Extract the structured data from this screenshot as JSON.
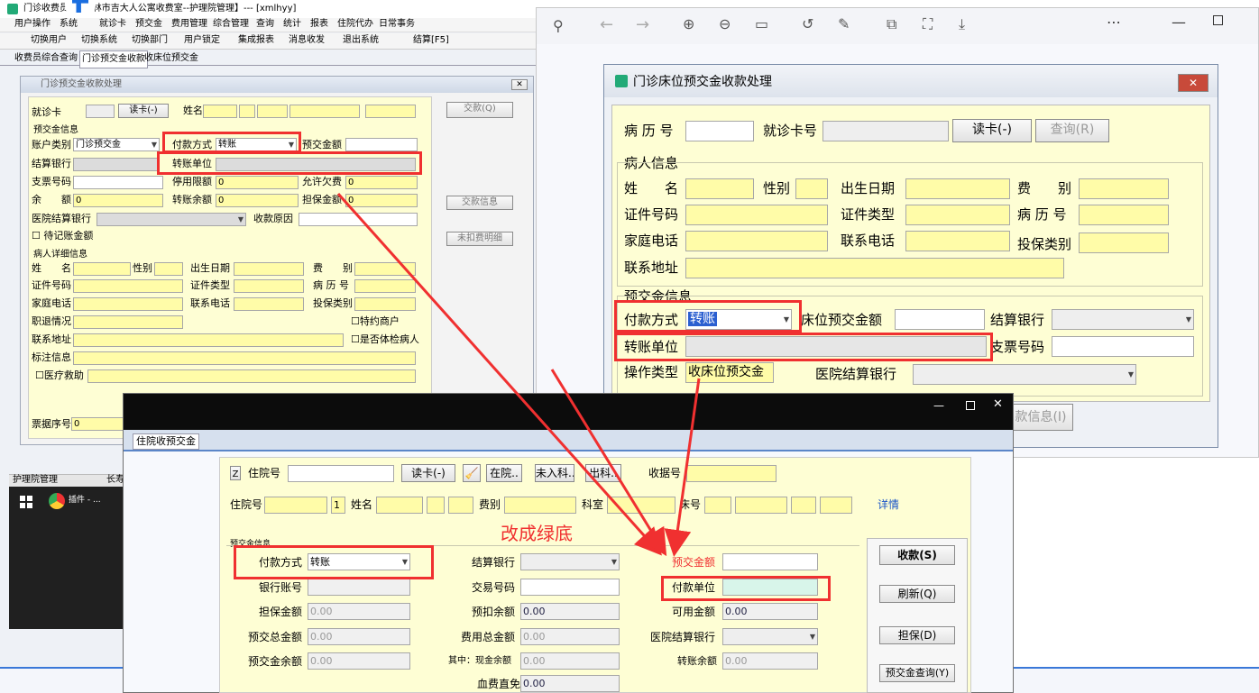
{
  "main": {
    "title": "门诊收费员-...-吉林市吉大人公寓收费室--护理院管理】--- [xmlhyy]",
    "menu": [
      "用户操作",
      "系统",
      "就诊卡",
      "预交金",
      "费用管理",
      "综合管理",
      "查询",
      "统计",
      "报表",
      "住院代办",
      "日常事务"
    ],
    "toolbar": [
      "切换用户",
      "切换系统",
      "切换部门",
      "用户锁定",
      "集成报表",
      "消息收发",
      "退出系统",
      "结算[F5]"
    ],
    "tabs": [
      "收费员综合查询",
      "门诊预交金收款",
      "收床位预交金"
    ],
    "dialog": {
      "title": "门诊预交金收款处理",
      "card_label": "就诊卡",
      "read_card": "读卡(-)",
      "name_label": "姓名",
      "prepay_group": "预交金信息",
      "account_type_label": "账户类别",
      "account_type_value": "门诊预交金",
      "pay_method_label": "付款方式",
      "pay_method_value": "转账",
      "prepay_amount_label": "预交金额",
      "settle_bank_label": "结算银行",
      "transfer_unit_label": "转账单位",
      "check_no_label": "支票号码",
      "disabled_limit_label": "停用限额",
      "disabled_limit_value": "0",
      "allow_debt_label": "允许欠费",
      "allow_debt_value": "0",
      "balance_label": "余　　额",
      "balance_value": "0",
      "transfer_balance_label": "转账余额",
      "transfer_balance_value": "0",
      "guarantee_label": "担保金额",
      "guarantee_value": "0",
      "hospital_bank_label": "医院结算银行",
      "reason_label": "收款原因",
      "pending_label": "待记账金额",
      "patient_group": "病人详细信息",
      "p_name": "姓　　名",
      "p_gender": "性别",
      "p_birth": "出生日期",
      "p_fee": "费　　别",
      "p_id": "证件号码",
      "p_idtype": "证件类型",
      "p_record": "病 历 号",
      "p_home": "家庭电话",
      "p_contact_phone": "联系电话",
      "p_ins": "投保类别",
      "p_job": "职退情况",
      "p_special": "特约商户",
      "p_addr": "联系地址",
      "p_exam": "是否体检病人",
      "p_mark": "标注信息",
      "p_aid": "医疗救助",
      "receipt_label": "票据序号",
      "receipt_value": "0",
      "btn_pay": "交款(Q)",
      "btn_info": "交款信息",
      "btn_detail": "未扣费明细"
    },
    "bottom_tabs": [
      "护理院管理",
      "长寿"
    ]
  },
  "taskbar": {
    "app": "插件 - ..."
  },
  "viewer": {
    "dialog": {
      "title": "门诊床位预交金收款处理",
      "record_label": "病 历 号",
      "card_label": "就诊卡号",
      "read_card": "读卡(-)",
      "query": "查询(R)",
      "patient_group": "病人信息",
      "name": "姓　　名",
      "gender": "性别",
      "birth": "出生日期",
      "fee": "费　　别",
      "id": "证件号码",
      "idtype": "证件类型",
      "record": "病 历 号",
      "home": "家庭电话",
      "contact_phone": "联系电话",
      "ins": "投保类别",
      "addr": "联系地址",
      "prepay_group": "预交金信息",
      "pay_method": "付款方式",
      "pay_method_value": "转账",
      "bed_amount": "床位预交金额",
      "settle_bank": "结算银行",
      "transfer_unit": "转账单位",
      "check_no": "支票号码",
      "op_type": "操作类型",
      "op_type_value": "收床位预交金",
      "hospital_bank": "医院结算银行",
      "pay_info_btn": "款信息(I)"
    }
  },
  "bottom": {
    "tab": "住院收预交金",
    "zhuyuan_label": "住院号",
    "read_card": "读卡(-)",
    "in_hosp": "在院..",
    "not_in": "未入科..",
    "out": "出科..",
    "receipt_label": "收据号",
    "row2": [
      "住院号",
      "姓名",
      "费别",
      "科室",
      "床号"
    ],
    "row2_num": "1",
    "detail": "详情",
    "annotation": "改成绿底",
    "group": "预交金信息",
    "pay_method": "付款方式",
    "pay_method_value": "转账",
    "settle_bank": "结算银行",
    "prepay_amount": "预交金额",
    "bank_account": "银行账号",
    "txn_no": "交易号码",
    "pay_unit": "付款单位",
    "guarantee": "担保金额",
    "guarantee_value": "0.00",
    "prededuct": "预扣余额",
    "prededuct_value": "0.00",
    "available": "可用金额",
    "available_value": "0.00",
    "prepay_total": "预交总金额",
    "prepay_total_value": "0.00",
    "fee_total": "费用总金额",
    "fee_total_value": "0.00",
    "hospital_bank": "医院结算银行",
    "prepay_balance": "预交金余额",
    "prepay_balance_value": "0.00",
    "cash_balance": "其中：现金余额",
    "cash_balance_value": "0.00",
    "transfer_balance": "转账余额",
    "transfer_balance_value": "0.00",
    "blood_free": "血费直免",
    "blood_free_value": "0.00",
    "btn_receive": "收款(S)",
    "btn_refresh": "刷新(Q)",
    "btn_guarantee": "担保(D)",
    "btn_query": "预交金查询(Y)"
  },
  "colors": {
    "red": "#f03030",
    "yellow_field": "#fffca8",
    "green_target": "#d8f5ea"
  }
}
